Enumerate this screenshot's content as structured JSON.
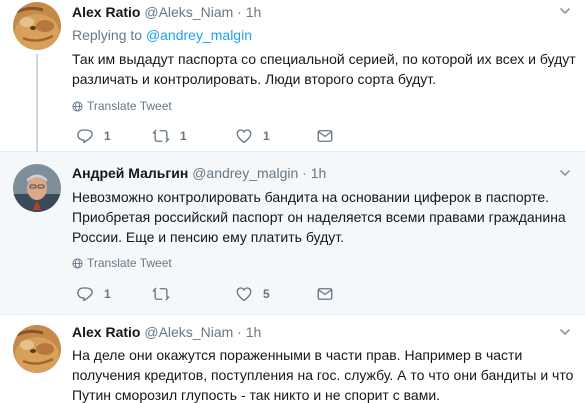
{
  "colors": {
    "link": "#1da1f2",
    "muted": "#657786",
    "text": "#14171a",
    "highlight_bg": "#f5f8fa"
  },
  "tweets": [
    {
      "name": "Alex Ratio",
      "handle": "@Aleks_Niam",
      "dot": "·",
      "time": "1h",
      "replying_label": "Replying to",
      "replying_to": "@andrey_malgin",
      "text": "Так им выдадут паспорта со специальной серией, по которой их всех и будут различать и контролировать. Люди второго сорта будут.",
      "translate": "Translate Tweet",
      "replies": "1",
      "retweets": "1",
      "likes": "1"
    },
    {
      "name": "Андрей Мальгин",
      "handle": "@andrey_malgin",
      "dot": "·",
      "time": "1h",
      "text": "Невозможно контролировать бандита на основании циферок в паспорте. Приобретая российский паспорт он наделяется всеми правами гражданина России. Еще и пенсию ему платить будут.",
      "translate": "Translate Tweet",
      "replies": "1",
      "retweets": "",
      "likes": "5"
    },
    {
      "name": "Alex Ratio",
      "handle": "@Aleks_Niam",
      "dot": "·",
      "time": "1h",
      "text": "На деле они окажутся пораженными в части прав. Например в части получения кредитов, поступления на гос. службу. А то что они бандиты и что Путин сморозил глупость - так никто и не спорит с вами."
    }
  ]
}
